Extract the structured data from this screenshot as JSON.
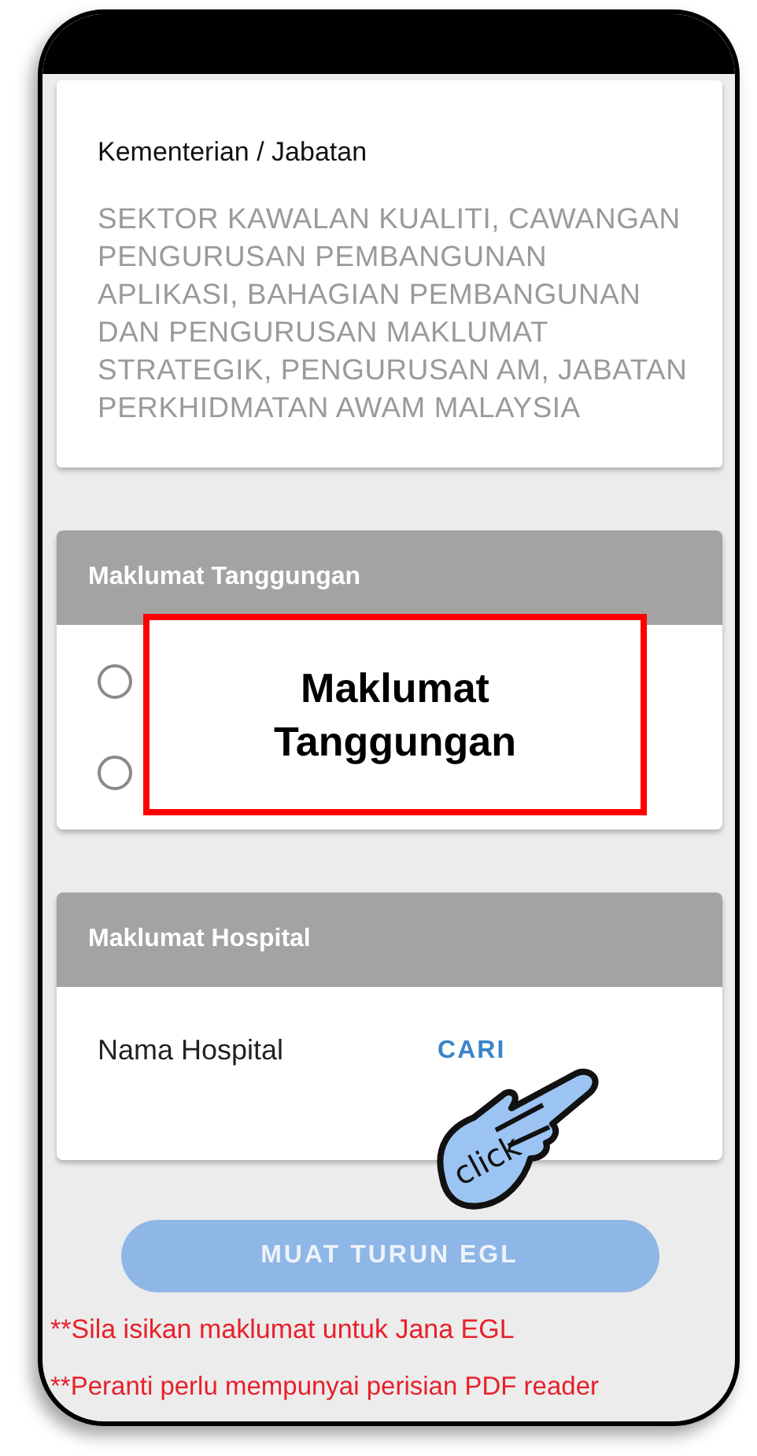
{
  "ministry": {
    "label": "Kementerian / Jabatan",
    "value": "SEKTOR KAWALAN KUALITI, CAWANGAN PENGURUSAN PEMBANGUNAN APLIKASI, BAHAGIAN PEMBANGUNAN DAN PENGURUSAN MAKLUMAT STRATEGIK, PENGURUSAN AM, JABATAN PERKHIDMATAN AWAM MALAYSIA"
  },
  "dependents": {
    "title": "Maklumat Tanggungan",
    "options": [
      {
        "selected": false
      },
      {
        "selected": false
      }
    ]
  },
  "callout": {
    "text": "Maklumat Tanggungan"
  },
  "hospital": {
    "title": "Maklumat Hospital",
    "label": "Nama Hospital",
    "action": "CARI"
  },
  "click_hint": {
    "text": "click"
  },
  "download_button": {
    "label": "MUAT TURUN EGL",
    "disabled": true
  },
  "notes": [
    "**Sila isikan maklumat untuk Jana EGL",
    "**Peranti perlu mempunyai perisian PDF reader"
  ]
}
